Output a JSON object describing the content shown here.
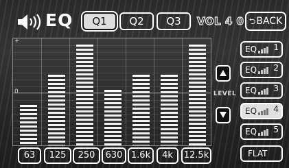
{
  "header": {
    "title": "EQ",
    "presets": [
      {
        "label": "Q1",
        "active": true
      },
      {
        "label": "Q2",
        "active": false
      },
      {
        "label": "Q3",
        "active": false
      }
    ],
    "volume": "VOL 4 0",
    "back_label": "BACK"
  },
  "graph": {
    "bands": [
      {
        "freq": "63",
        "level": 0.38
      },
      {
        "freq": "125",
        "level": 0.66
      },
      {
        "freq": "250",
        "level": 0.94
      },
      {
        "freq": "630",
        "level": 0.52
      },
      {
        "freq": "1.6k",
        "level": 0.66
      },
      {
        "freq": "4k",
        "level": 0.66
      },
      {
        "freq": "12.5k",
        "level": 0.94
      }
    ],
    "top_mark": "+",
    "zero_mark": "0"
  },
  "level": {
    "label": "LEVEL"
  },
  "eq_memory": [
    {
      "label": "EQ",
      "num": "1",
      "active": false
    },
    {
      "label": "EQ",
      "num": "2",
      "active": false
    },
    {
      "label": "EQ",
      "num": "3",
      "active": false
    },
    {
      "label": "EQ",
      "num": "4",
      "active": true
    },
    {
      "label": "EQ",
      "num": "5",
      "active": false
    }
  ],
  "flat_label": "FLAT",
  "colors": {
    "background": "#2a2a2a",
    "foreground": "#ffffff",
    "active": "#e0e0e0"
  }
}
